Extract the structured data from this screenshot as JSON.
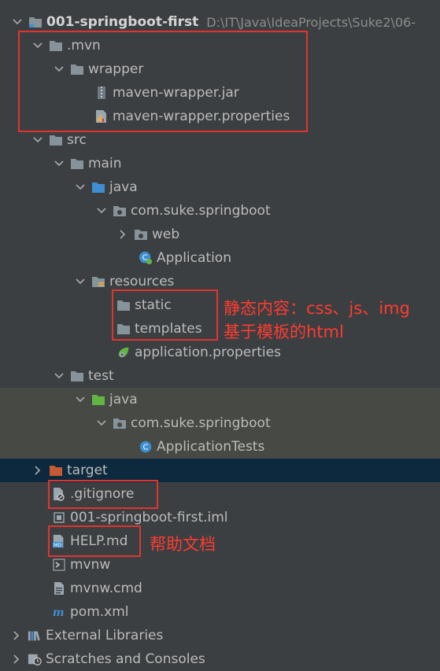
{
  "project": {
    "name": "001-springboot-first",
    "path": "D:\\IT\\Java\\IdeaProjects\\Suke2\\06-"
  },
  "nodes": {
    "mvn": ".mvn",
    "wrapper": "wrapper",
    "wrapper_jar": "maven-wrapper.jar",
    "wrapper_props": "maven-wrapper.properties",
    "src": "src",
    "main": "main",
    "main_java": "java",
    "main_pkg": "com.suke.springboot",
    "web": "web",
    "application": "Application",
    "resources": "resources",
    "static": "static",
    "templates": "templates",
    "app_props": "application.properties",
    "test": "test",
    "test_java": "java",
    "test_pkg": "com.suke.springboot",
    "app_tests": "ApplicationTests",
    "target": "target",
    "gitignore": ".gitignore",
    "iml": "001-springboot-first.iml",
    "help": "HELP.md",
    "mvnw": "mvnw",
    "mvnw_cmd": "mvnw.cmd",
    "pom": "pom.xml",
    "ext_libs": "External Libraries",
    "scratches": "Scratches and Consoles"
  },
  "annotations": {
    "static_note": "静态内容：css、js、img",
    "templates_note": "基于模板的html",
    "help_note": "帮助文档"
  },
  "colors": {
    "background": "#3c3f41",
    "selected_row": "#0d293e",
    "annotation": "#e0342f",
    "folder": "#87939a",
    "source_folder": "#3d8fd1",
    "test_folder": "#62b543",
    "excluded_folder": "#c55a33"
  }
}
